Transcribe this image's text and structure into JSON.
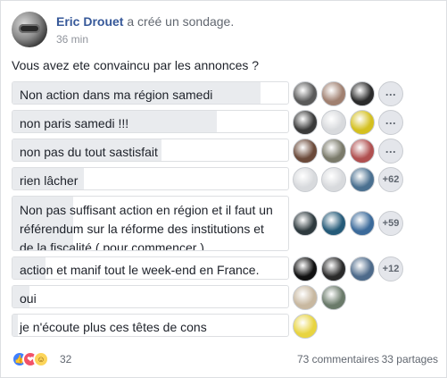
{
  "post": {
    "author": "Eric Drouet",
    "action": "a créé un sondage.",
    "timestamp": "36 min",
    "question": "Vous avez ete convaincu par les annonces ?"
  },
  "options": [
    {
      "label": "Non action dans ma région samedi",
      "fill": 0.9,
      "voters": [
        "#5a5a5a",
        "#a08070",
        "#2b2b2b"
      ],
      "more": "..."
    },
    {
      "label": "non paris samedi !!!",
      "fill": 0.74,
      "voters": [
        "#3a3a3a",
        "#d8dadd",
        "#d4c020"
      ],
      "more": "..."
    },
    {
      "label": "non pas du tout sastisfait",
      "fill": 0.54,
      "voters": [
        "#6b4a3a",
        "#7a7a6a",
        "#b05050"
      ],
      "more": "..."
    },
    {
      "label": "rien lâcher",
      "fill": 0.26,
      "voters": [
        "#d8dadd",
        "#d8dadd",
        "#4a7090"
      ],
      "more": "+62"
    },
    {
      "label": "Non pas suffisant action en région et il faut un référendum sur la réforme des institutions et de la fiscalité ( pour commencer )",
      "fill": 0.22,
      "voters": [
        "#2e3a3e",
        "#245a78",
        "#3b6a9a"
      ],
      "more": "+59"
    },
    {
      "label": "action et manif tout le week-end en France.",
      "fill": 0.12,
      "voters": [
        "#111111",
        "#2a2a2a",
        "#4d6a8a"
      ],
      "more": "+12"
    },
    {
      "label": "oui",
      "fill": 0.06,
      "voters": [
        "#c8b8a0",
        "#6a7a6a"
      ],
      "more": ""
    },
    {
      "label": "je n'écoute plus ces têtes de cons",
      "fill": 0.02,
      "voters": [
        "#e8d440"
      ],
      "more": ""
    }
  ],
  "footer": {
    "reaction_count": "32",
    "comments": "73 commentaires",
    "shares": "33 partages"
  },
  "icons": [
    "like-icon",
    "love-icon",
    "haha-icon"
  ]
}
